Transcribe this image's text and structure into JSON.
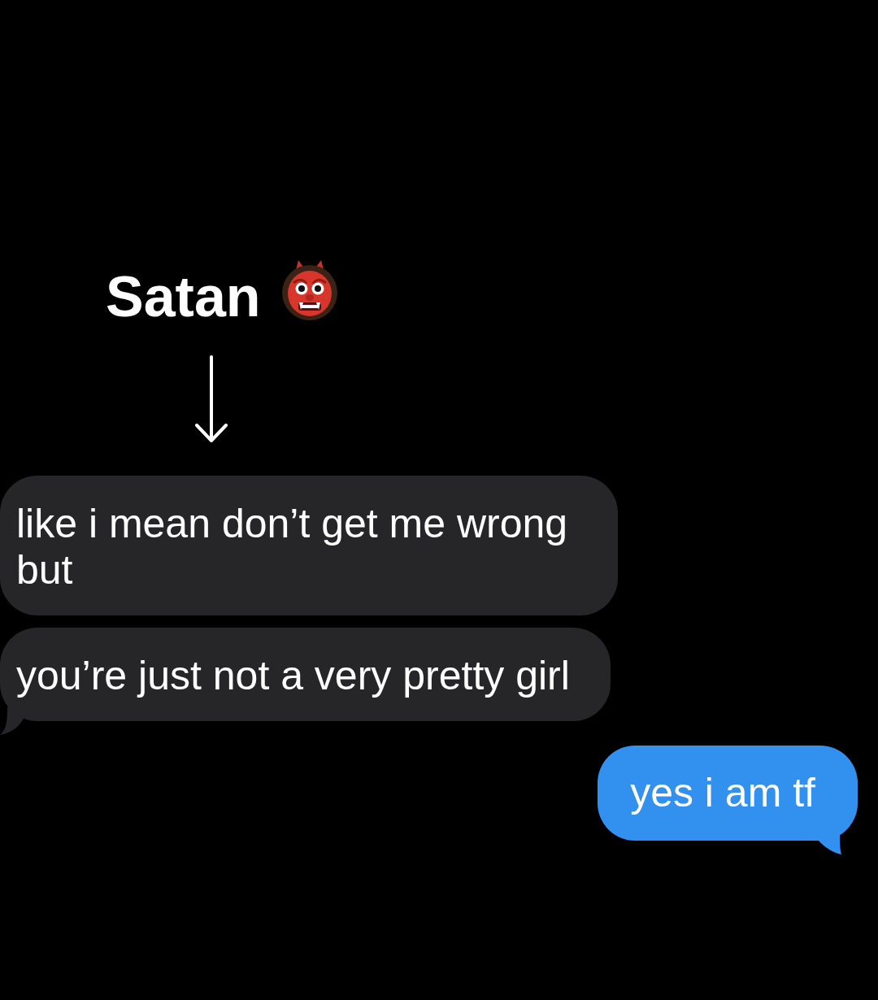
{
  "caption": {
    "label": "Satan"
  },
  "messages": [
    {
      "kind": "received",
      "text": "like i mean don’t get me wrong but",
      "tail": false
    },
    {
      "kind": "received",
      "text": "you’re just not a very pretty girl",
      "tail": true
    },
    {
      "kind": "sent",
      "text": "yes i am tf",
      "tail": true
    }
  ]
}
